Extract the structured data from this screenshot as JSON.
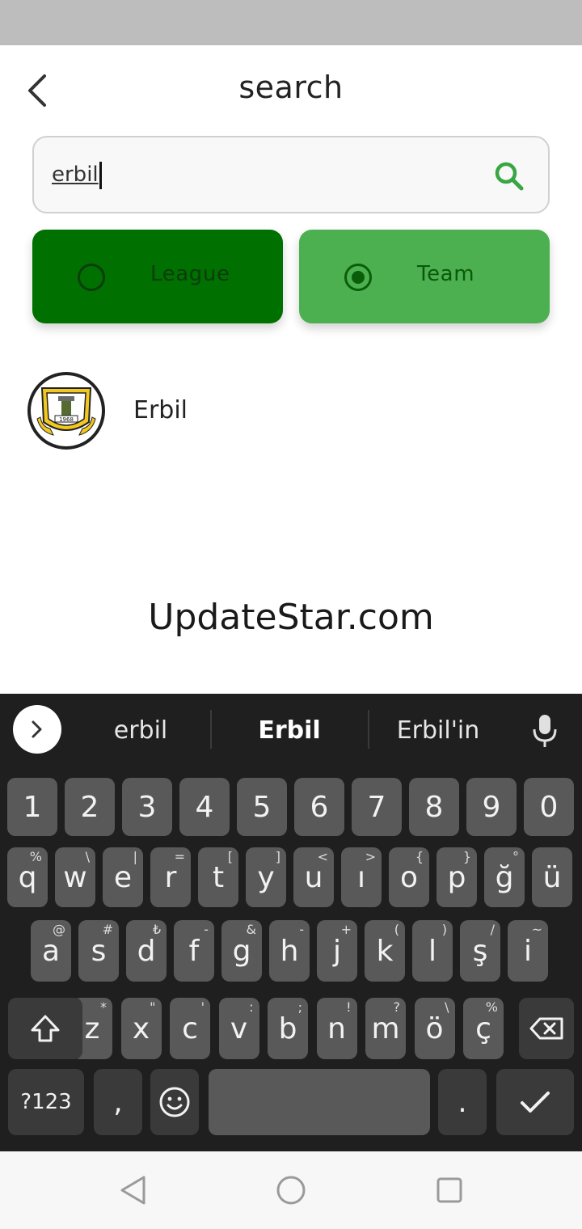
{
  "header": {
    "title": "search"
  },
  "search": {
    "value": "erbil",
    "placeholder": ""
  },
  "filters": [
    {
      "label": "League",
      "checked": false
    },
    {
      "label": "Team",
      "checked": true
    }
  ],
  "results": [
    {
      "name": "Erbil",
      "logo_year": "1968"
    }
  ],
  "watermark": "UpdateStar.com",
  "keyboard": {
    "suggestions": [
      "erbil",
      "Erbil",
      "Erbil'in"
    ],
    "row_numbers": [
      "1",
      "2",
      "3",
      "4",
      "5",
      "6",
      "7",
      "8",
      "9",
      "0"
    ],
    "row1": [
      {
        "k": "q",
        "h": "%"
      },
      {
        "k": "w",
        "h": "\\"
      },
      {
        "k": "e",
        "h": "|"
      },
      {
        "k": "r",
        "h": "="
      },
      {
        "k": "t",
        "h": "["
      },
      {
        "k": "y",
        "h": "]"
      },
      {
        "k": "u",
        "h": "<"
      },
      {
        "k": "ı",
        "h": ">"
      },
      {
        "k": "o",
        "h": "{"
      },
      {
        "k": "p",
        "h": "}"
      },
      {
        "k": "ğ",
        "h": "°"
      },
      {
        "k": "ü",
        "h": ""
      }
    ],
    "row2": [
      {
        "k": "a",
        "h": "@"
      },
      {
        "k": "s",
        "h": "#"
      },
      {
        "k": "d",
        "h": "₺"
      },
      {
        "k": "f",
        "h": "-"
      },
      {
        "k": "g",
        "h": "&"
      },
      {
        "k": "h",
        "h": "-"
      },
      {
        "k": "j",
        "h": "+"
      },
      {
        "k": "k",
        "h": "("
      },
      {
        "k": "l",
        "h": ")"
      },
      {
        "k": "ş",
        "h": "/"
      },
      {
        "k": "i",
        "h": "~"
      }
    ],
    "row3": [
      {
        "k": "z",
        "h": "*"
      },
      {
        "k": "x",
        "h": "\""
      },
      {
        "k": "c",
        "h": "'"
      },
      {
        "k": "v",
        "h": ":"
      },
      {
        "k": "b",
        "h": ";"
      },
      {
        "k": "n",
        "h": "!"
      },
      {
        "k": "m",
        "h": "?"
      },
      {
        "k": "ö",
        "h": "\\"
      },
      {
        "k": "ç",
        "h": "%"
      }
    ],
    "symbols_label": "?123",
    "comma": ",",
    "period": "."
  },
  "colors": {
    "accent_green": "#4caf50",
    "dark_green": "#007000",
    "keyboard_bg": "#1f1f1f",
    "key_bg": "#595959"
  }
}
